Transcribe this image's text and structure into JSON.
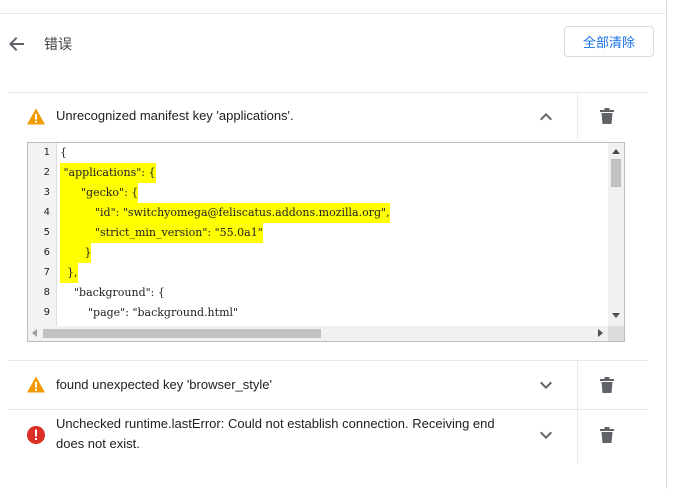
{
  "header": {
    "title": "错误",
    "clear_all_label": "全部清除"
  },
  "errors": [
    {
      "severity": "warning",
      "message": "Unrecognized manifest key 'applications'.",
      "expanded": true
    },
    {
      "severity": "warning",
      "message": "found unexpected key 'browser_style'",
      "expanded": false
    },
    {
      "severity": "error",
      "message_line1": "Unchecked runtime.lastError: Could not establish connection. Receiving end",
      "message_line2": "does not exist.",
      "expanded": false
    }
  ],
  "code": {
    "lines": [
      {
        "n": "1",
        "indent": "",
        "text": "{",
        "highlight": false
      },
      {
        "n": "2",
        "indent": "  ",
        "text": " \"applications\": {",
        "highlight": true
      },
      {
        "n": "3",
        "indent": "  ",
        "text": "      \"gecko\": {",
        "highlight": true
      },
      {
        "n": "4",
        "indent": "  ",
        "text": "          \"id\": \"switchyomega@feliscatus.addons.mozilla.org\",",
        "highlight": true
      },
      {
        "n": "5",
        "indent": "  ",
        "text": "          \"strict_min_version\": \"55.0a1\"",
        "highlight": true
      },
      {
        "n": "6",
        "indent": "  ",
        "text": "       }",
        "highlight": true
      },
      {
        "n": "7",
        "indent": "  ",
        "text": "  },",
        "highlight": true
      },
      {
        "n": "8",
        "indent": "",
        "text": "    \"background\": {",
        "highlight": false
      },
      {
        "n": "9",
        "indent": "",
        "text": "        \"page\": \"background.html\"",
        "highlight": false
      }
    ]
  },
  "colors": {
    "accent": "#1a73e8",
    "warning": "#f29900",
    "error": "#d93025",
    "highlight": "#ffff00"
  },
  "icons": {
    "back": "arrow-back-icon",
    "warning": "warning-triangle-icon",
    "error": "error-circle-icon",
    "chevron_up": "chevron-up-icon",
    "chevron_down": "chevron-down-icon",
    "trash": "trash-icon"
  }
}
